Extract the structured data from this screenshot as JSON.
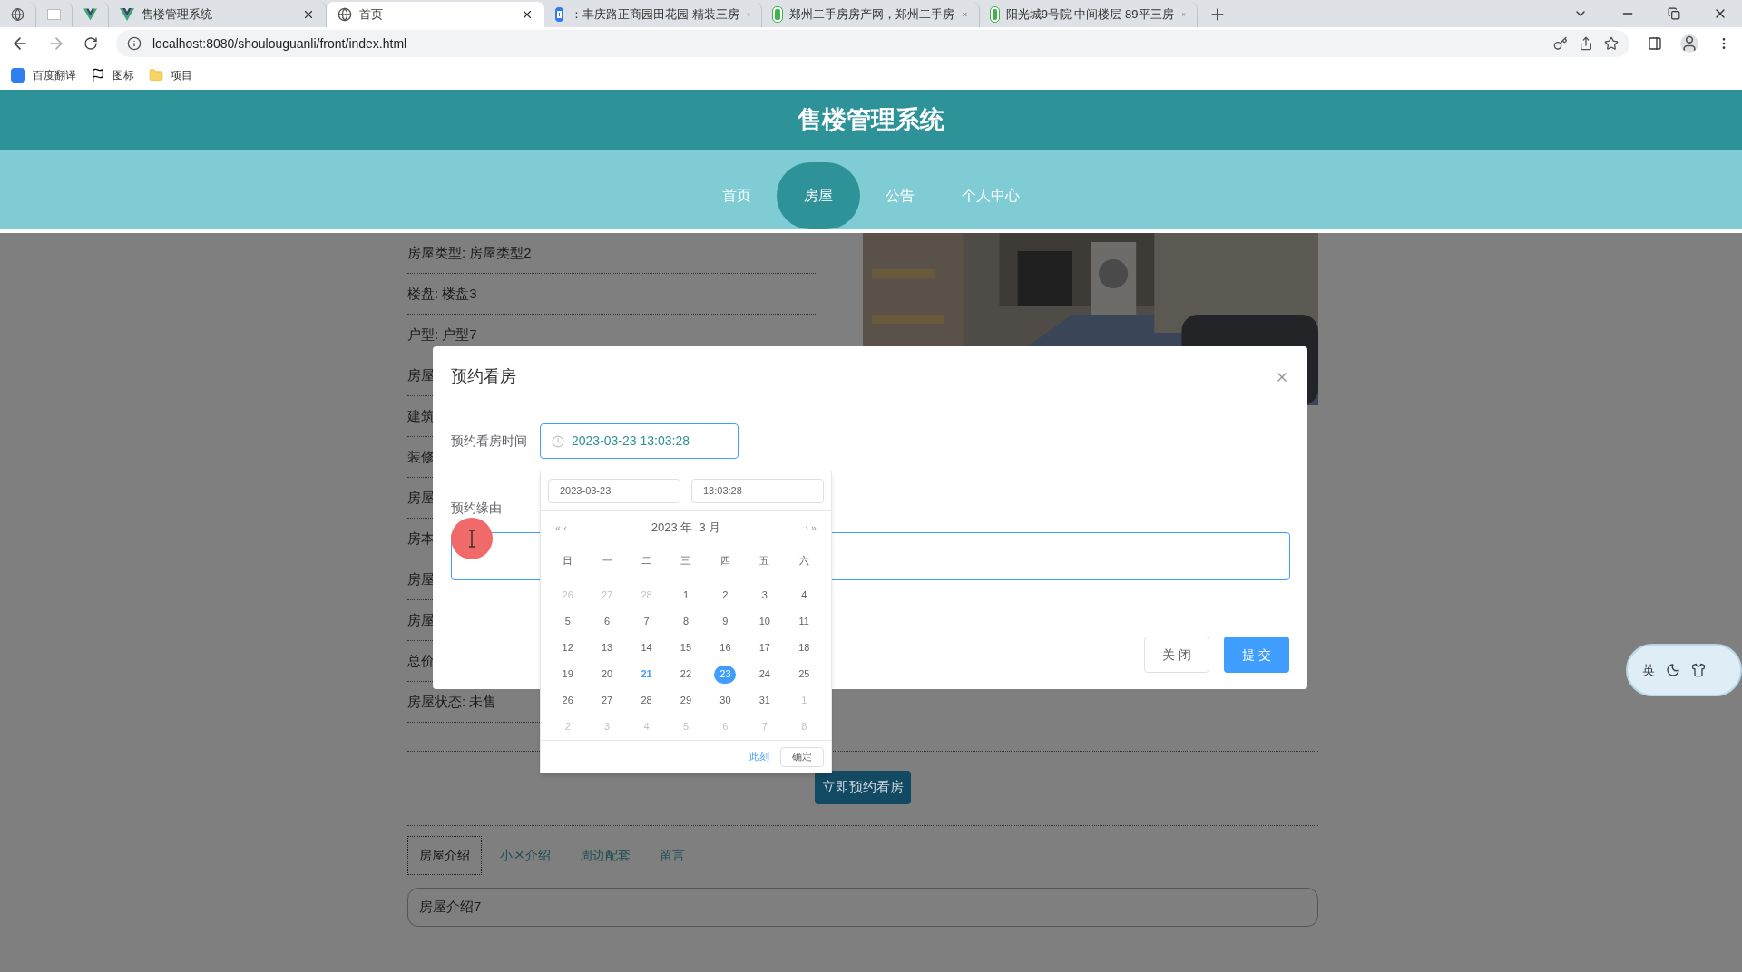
{
  "browser": {
    "tabs": [
      {
        "kind": "globe",
        "selected": false
      },
      {
        "kind": "blank",
        "selected": false
      },
      {
        "kind": "vue",
        "selected": false
      },
      {
        "kind": "vue",
        "title": "售楼管理系统",
        "selected": false
      },
      {
        "kind": "globe",
        "title": "首页",
        "selected": true
      },
      {
        "kind": "ring",
        "title": "：丰庆路正商园田花园 精装三房",
        "selected": false
      },
      {
        "kind": "an",
        "title": "郑州二手房房产网，郑州二手房",
        "selected": false
      },
      {
        "kind": "an",
        "title": "阳光城9号院 中间楼层 89平三房",
        "selected": false
      }
    ],
    "url": "localhost:8080/shoulouguanli/front/index.html",
    "bookmarks": [
      {
        "kind": "translate",
        "label": "百度翻译"
      },
      {
        "kind": "flag",
        "label": "图标"
      },
      {
        "kind": "folder",
        "label": "项目"
      }
    ]
  },
  "header": {
    "title": "售楼管理系统"
  },
  "nav": [
    {
      "label": "首页",
      "selected": false
    },
    {
      "label": "房屋",
      "selected": true
    },
    {
      "label": "公告",
      "selected": false
    },
    {
      "label": "个人中心",
      "selected": false
    }
  ],
  "details": [
    "房屋类型: 房屋类型2",
    "楼盘: 楼盘3",
    "户型: 户型7",
    "房屋",
    "建筑",
    "装修",
    "房屋",
    "房本",
    "房屋",
    "房屋",
    "总价",
    "房屋状态: 未售"
  ],
  "book_button": "立即预约看房",
  "info_tabs": [
    {
      "label": "房屋介绍",
      "selected": true
    },
    {
      "label": "小区介绍",
      "selected": false
    },
    {
      "label": "周边配套",
      "selected": false
    },
    {
      "label": "留言",
      "selected": false
    }
  ],
  "info_content": "房屋介绍7",
  "dialog": {
    "title": "预约看房",
    "time_label": "预约看房时间",
    "time_value": "2023-03-23 13:03:28",
    "reason_label": "预约缘由",
    "buttons": [
      {
        "label": "关 闭",
        "kind": "default"
      },
      {
        "label": "提 交",
        "kind": "primary"
      }
    ]
  },
  "picker": {
    "date": "2023-03-23",
    "time": "13:03:28",
    "prev": "« ‹",
    "next": "› »",
    "heading": "2023 年  3 月",
    "weekdays": [
      "日",
      "一",
      "二",
      "三",
      "四",
      "五",
      "六"
    ],
    "days": [
      {
        "label": "26",
        "muted": true,
        "today": false,
        "selected": false
      },
      {
        "label": "27",
        "muted": true,
        "today": false,
        "selected": false
      },
      {
        "label": "28",
        "muted": true,
        "today": false,
        "selected": false
      },
      {
        "label": "1",
        "muted": false,
        "today": false,
        "selected": false
      },
      {
        "label": "2",
        "muted": false,
        "today": false,
        "selected": false
      },
      {
        "label": "3",
        "muted": false,
        "today": false,
        "selected": false
      },
      {
        "label": "4",
        "muted": false,
        "today": false,
        "selected": false
      },
      {
        "label": "5",
        "muted": false,
        "today": false,
        "selected": false
      },
      {
        "label": "6",
        "muted": false,
        "today": false,
        "selected": false
      },
      {
        "label": "7",
        "muted": false,
        "today": false,
        "selected": false
      },
      {
        "label": "8",
        "muted": false,
        "today": false,
        "selected": false
      },
      {
        "label": "9",
        "muted": false,
        "today": false,
        "selected": false
      },
      {
        "label": "10",
        "muted": false,
        "today": false,
        "selected": false
      },
      {
        "label": "11",
        "muted": false,
        "today": false,
        "selected": false
      },
      {
        "label": "12",
        "muted": false,
        "today": false,
        "selected": false
      },
      {
        "label": "13",
        "muted": false,
        "today": false,
        "selected": false
      },
      {
        "label": "14",
        "muted": false,
        "today": false,
        "selected": false
      },
      {
        "label": "15",
        "muted": false,
        "today": false,
        "selected": false
      },
      {
        "label": "16",
        "muted": false,
        "today": false,
        "selected": false
      },
      {
        "label": "17",
        "muted": false,
        "today": false,
        "selected": false
      },
      {
        "label": "18",
        "muted": false,
        "today": false,
        "selected": false
      },
      {
        "label": "19",
        "muted": false,
        "today": false,
        "selected": false
      },
      {
        "label": "20",
        "muted": false,
        "today": false,
        "selected": false
      },
      {
        "label": "21",
        "muted": false,
        "today": true,
        "selected": false
      },
      {
        "label": "22",
        "muted": false,
        "today": false,
        "selected": false
      },
      {
        "label": "23",
        "muted": false,
        "today": false,
        "selected": true
      },
      {
        "label": "24",
        "muted": false,
        "today": false,
        "selected": false
      },
      {
        "label": "25",
        "muted": false,
        "today": false,
        "selected": false
      },
      {
        "label": "26",
        "muted": false,
        "today": false,
        "selected": false
      },
      {
        "label": "27",
        "muted": false,
        "today": false,
        "selected": false
      },
      {
        "label": "28",
        "muted": false,
        "today": false,
        "selected": false
      },
      {
        "label": "29",
        "muted": false,
        "today": false,
        "selected": false
      },
      {
        "label": "30",
        "muted": false,
        "today": false,
        "selected": false
      },
      {
        "label": "31",
        "muted": false,
        "today": false,
        "selected": false
      },
      {
        "label": "1",
        "muted": true,
        "today": false,
        "selected": false
      },
      {
        "label": "2",
        "muted": true,
        "today": false,
        "selected": false
      },
      {
        "label": "3",
        "muted": true,
        "today": false,
        "selected": false
      },
      {
        "label": "4",
        "muted": true,
        "today": false,
        "selected": false
      },
      {
        "label": "5",
        "muted": true,
        "today": false,
        "selected": false
      },
      {
        "label": "6",
        "muted": true,
        "today": false,
        "selected": false
      },
      {
        "label": "7",
        "muted": true,
        "today": false,
        "selected": false
      },
      {
        "label": "8",
        "muted": true,
        "today": false,
        "selected": false
      }
    ],
    "now": "此刻",
    "ok": "确定"
  },
  "ime": {
    "label": "英"
  }
}
